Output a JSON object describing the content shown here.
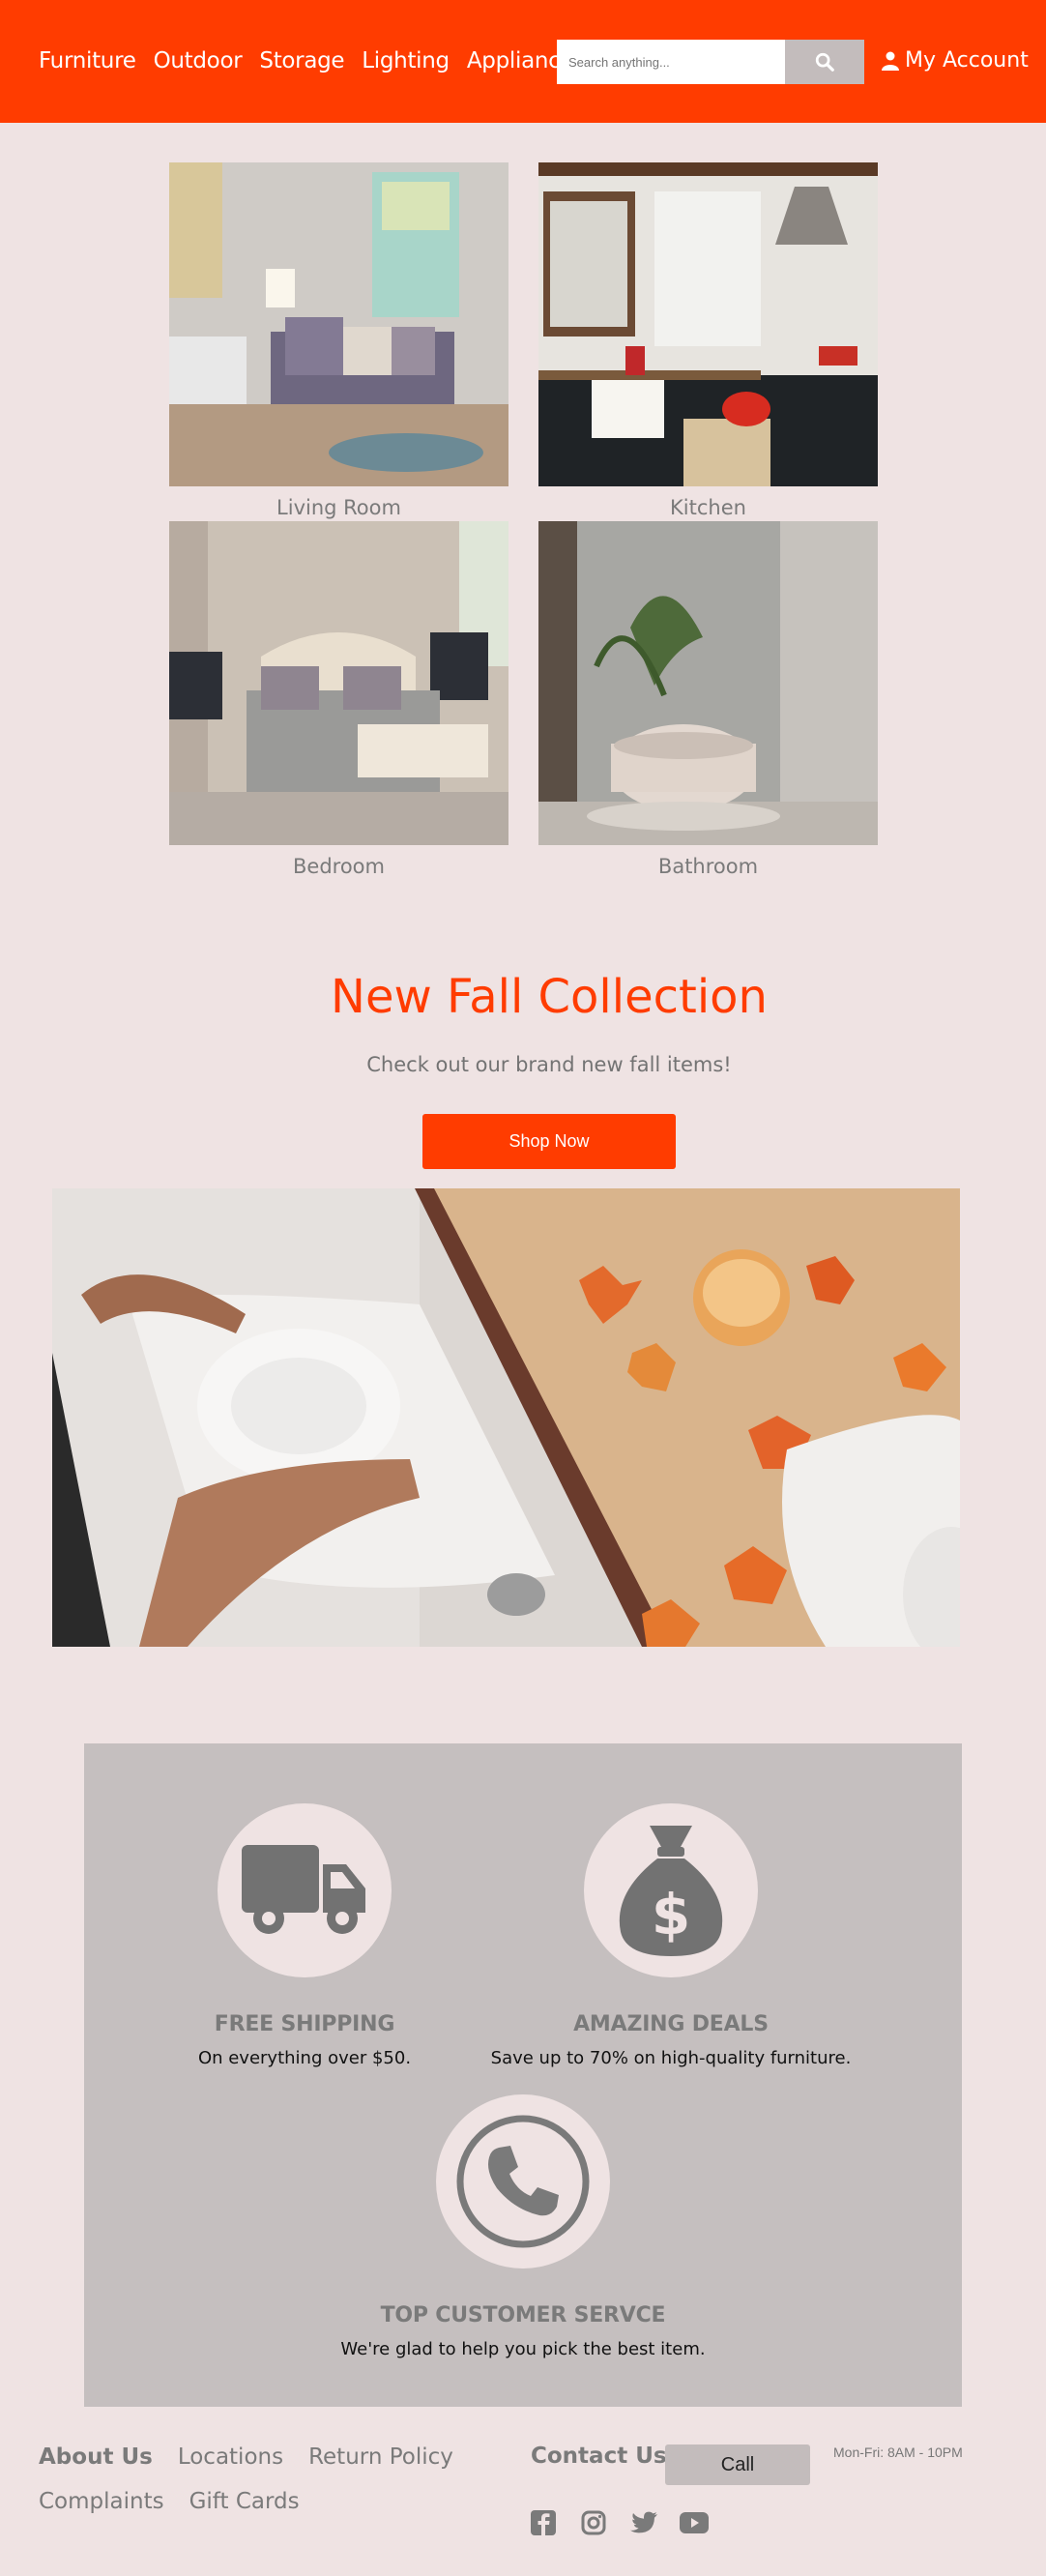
{
  "header": {
    "nav": [
      "Furniture",
      "Outdoor",
      "Storage",
      "Lighting",
      "Appliances"
    ],
    "search_placeholder": "Search anything...",
    "search_icon": "search-icon",
    "account_label": "My Account",
    "account_icon": "user-icon"
  },
  "rooms": [
    {
      "label": "Living Room"
    },
    {
      "label": "Kitchen"
    },
    {
      "label": "Bedroom"
    },
    {
      "label": "Bathroom"
    }
  ],
  "collection": {
    "title": "New Fall Collection",
    "subtitle": "Check out our brand new fall items!",
    "button": "Shop Now"
  },
  "features": [
    {
      "icon": "truck-icon",
      "title": "FREE SHIPPING",
      "text": "On everything over $50."
    },
    {
      "icon": "money-bag-icon",
      "title": "AMAZING DEALS",
      "text": "Save up to 70% on high-quality furniture."
    },
    {
      "icon": "phone-icon",
      "title": "TOP CUSTOMER SERVCE",
      "text": "We're glad to help you pick the best item."
    }
  ],
  "footer": {
    "links": [
      "About Us",
      "Locations",
      "Return Policy",
      "Complaints",
      "Gift Cards"
    ],
    "contact_label": "Contact Us",
    "call_button": "Call",
    "hours": "Mon-Fri: 8AM - 10PM",
    "social": [
      "facebook-icon",
      "instagram-icon",
      "twitter-icon",
      "youtube-icon"
    ]
  },
  "colors": {
    "accent": "#ff3c00",
    "background": "#efe3e3",
    "panel": "#c5bfbf",
    "button_gray": "#c3bcbc"
  }
}
